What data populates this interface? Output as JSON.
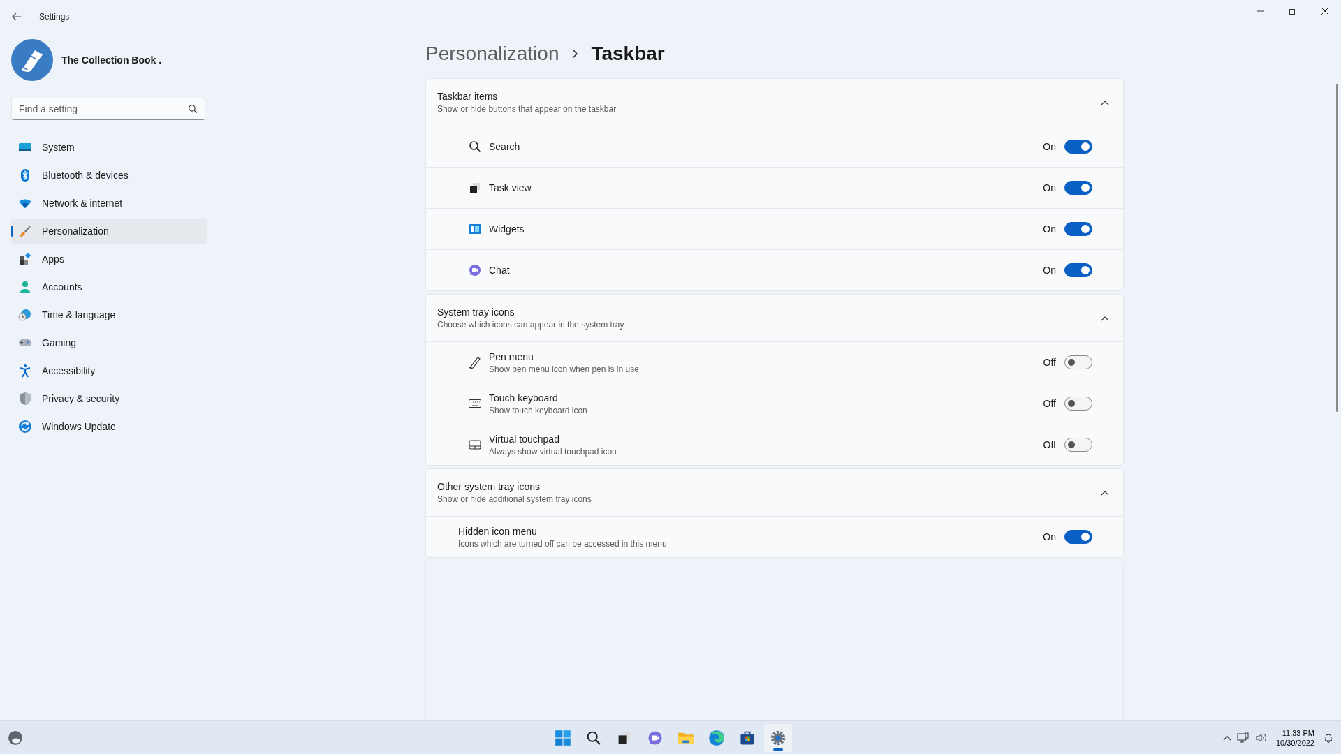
{
  "window": {
    "title": "Settings"
  },
  "profile": {
    "name": "The Collection Book ."
  },
  "search": {
    "placeholder": "Find a setting"
  },
  "nav": [
    {
      "kind": "system",
      "label": "System",
      "selected": false
    },
    {
      "kind": "bluetooth",
      "label": "Bluetooth & devices",
      "selected": false
    },
    {
      "kind": "network",
      "label": "Network & internet",
      "selected": false
    },
    {
      "kind": "brush",
      "label": "Personalization",
      "selected": true
    },
    {
      "kind": "apps",
      "label": "Apps",
      "selected": false
    },
    {
      "kind": "accounts",
      "label": "Accounts",
      "selected": false
    },
    {
      "kind": "time",
      "label": "Time & language",
      "selected": false
    },
    {
      "kind": "gaming",
      "label": "Gaming",
      "selected": false
    },
    {
      "kind": "accessibility",
      "label": "Accessibility",
      "selected": false
    },
    {
      "kind": "privacy",
      "label": "Privacy & security",
      "selected": false
    },
    {
      "kind": "update",
      "label": "Windows Update",
      "selected": false
    }
  ],
  "breadcrumb": {
    "parent": "Personalization",
    "current": "Taskbar"
  },
  "sections": [
    {
      "title": "Taskbar items",
      "subtitle": "Show or hide buttons that appear on the taskbar",
      "expanded": true,
      "items": [
        {
          "kind": "search",
          "label": "Search",
          "state_text": "On",
          "on": true
        },
        {
          "kind": "taskview",
          "label": "Task view",
          "state_text": "On",
          "on": true
        },
        {
          "kind": "widgets",
          "label": "Widgets",
          "state_text": "On",
          "on": true
        },
        {
          "kind": "chat",
          "label": "Chat",
          "state_text": "On",
          "on": true
        }
      ]
    },
    {
      "title": "System tray icons",
      "subtitle": "Choose which icons can appear in the system tray",
      "expanded": true,
      "items": [
        {
          "kind": "pen",
          "label": "Pen menu",
          "description": "Show pen menu icon when pen is in use",
          "state_text": "Off",
          "on": false
        },
        {
          "kind": "keyboard",
          "label": "Touch keyboard",
          "description": "Show touch keyboard icon",
          "state_text": "Off",
          "on": false
        },
        {
          "kind": "touchpad",
          "label": "Virtual touchpad",
          "description": "Always show virtual touchpad icon",
          "state_text": "Off",
          "on": false
        }
      ]
    },
    {
      "title": "Other system tray icons",
      "subtitle": "Show or hide additional system tray icons",
      "expanded": true,
      "items": [
        {
          "kind": "none",
          "label": "Hidden icon menu",
          "description": "Icons which are turned off can be accessed in this menu",
          "state_text": "On",
          "on": true
        }
      ]
    }
  ],
  "taskbar": {
    "apps": [
      {
        "kind": "start",
        "selected": false
      },
      {
        "kind": "search",
        "selected": false
      },
      {
        "kind": "taskview",
        "selected": false
      },
      {
        "kind": "chat",
        "selected": false
      },
      {
        "kind": "explorer",
        "selected": false
      },
      {
        "kind": "edge",
        "selected": false
      },
      {
        "kind": "store",
        "selected": false
      },
      {
        "kind": "settings",
        "selected": true
      }
    ],
    "clock": {
      "time": "11:33 PM",
      "date": "10/30/2022"
    }
  }
}
